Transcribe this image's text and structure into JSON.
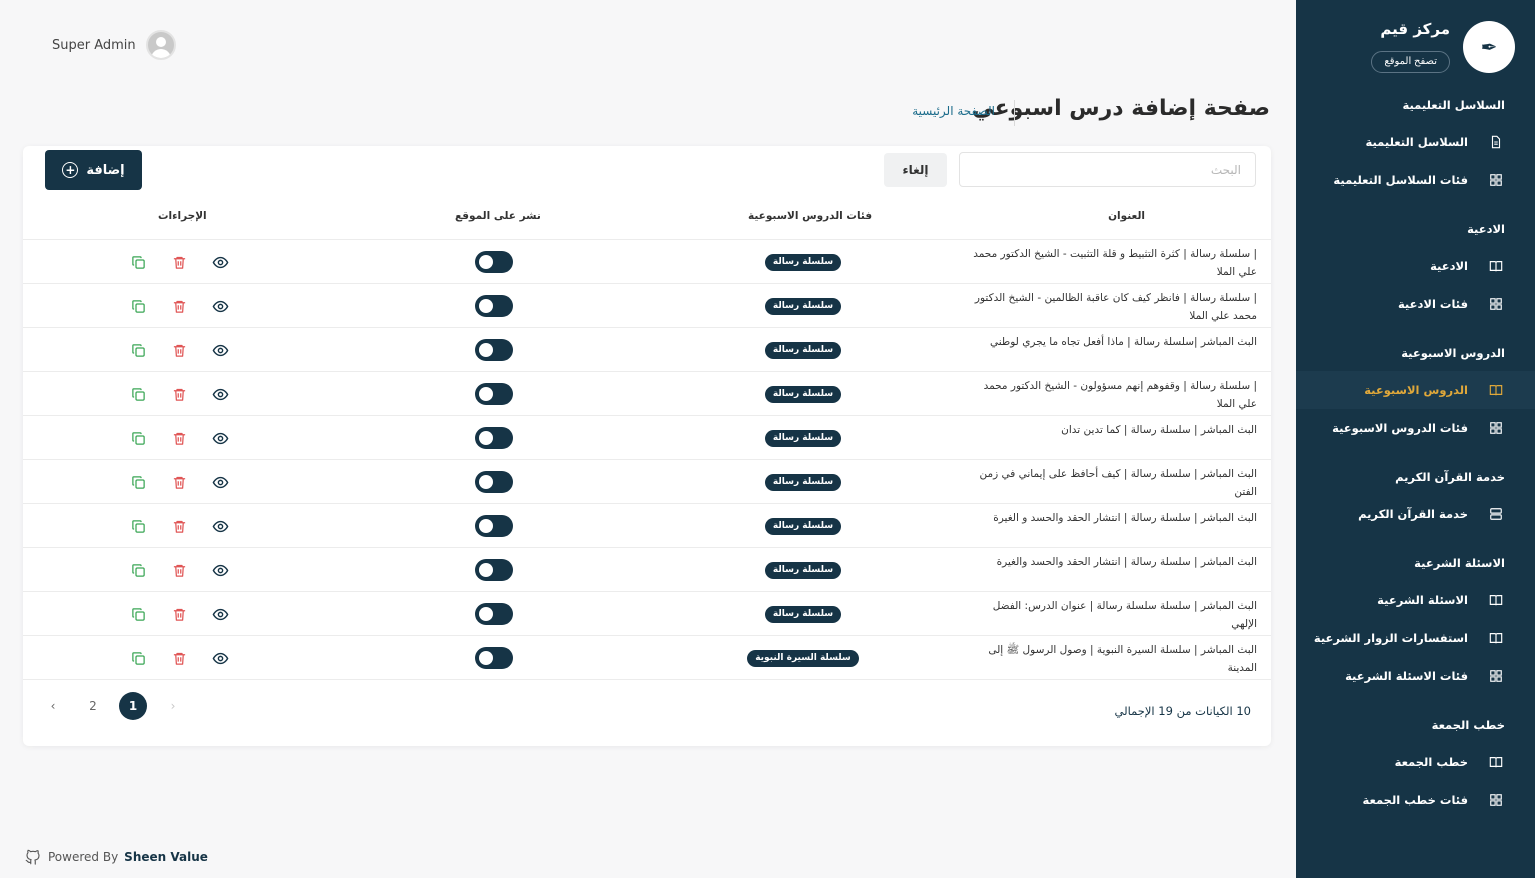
{
  "header": {
    "user_name": "Super Admin",
    "page_title": "صفحة إضافة درس اسبوعي",
    "breadcrumb_home": "الصفحة الرئيسية"
  },
  "sidebar": {
    "brand_name": "مركز قيم",
    "browse_site": "تصفح الموقع",
    "sections": [
      {
        "title": "السلاسل التعليمية",
        "items": [
          {
            "label": "السلاسل التعليمية",
            "icon": "document-icon",
            "active": false
          },
          {
            "label": "فئات السلاسل التعليمية",
            "icon": "grid-icon",
            "active": false
          }
        ]
      },
      {
        "title": "الادعية",
        "items": [
          {
            "label": "الادعية",
            "icon": "book-icon",
            "active": false
          },
          {
            "label": "فئات الادعية",
            "icon": "grid-icon",
            "active": false
          }
        ]
      },
      {
        "title": "الدروس الاسبوعية",
        "items": [
          {
            "label": "الدروس الاسبوعية",
            "icon": "book-icon",
            "active": true
          },
          {
            "label": "فئات الدروس الاسبوعية",
            "icon": "grid-icon",
            "active": false
          }
        ]
      },
      {
        "title": "خدمة القرآن الكريم",
        "items": [
          {
            "label": "خدمة القرآن الكريم",
            "icon": "server-icon",
            "active": false
          }
        ]
      },
      {
        "title": "الاسئلة الشرعية",
        "items": [
          {
            "label": "الاسئلة الشرعية",
            "icon": "book-icon",
            "active": false
          },
          {
            "label": "استفسارات الزوار الشرعية",
            "icon": "book-icon",
            "active": false
          },
          {
            "label": "فئات الاسئلة الشرعية",
            "icon": "grid-icon",
            "active": false
          }
        ]
      },
      {
        "title": "خطب الجمعة",
        "items": [
          {
            "label": "خطب الجمعة",
            "icon": "book-icon",
            "active": false
          },
          {
            "label": "فئات خطب الجمعة",
            "icon": "grid-icon",
            "active": false
          }
        ]
      }
    ]
  },
  "toolbar": {
    "add_label": "إضافة",
    "cancel_label": "إلغاء",
    "search_placeholder": "البحث"
  },
  "table": {
    "columns": {
      "title": "العنوان",
      "category": "فئات الدروس الاسبوعية",
      "publish": "نشر على الموقع",
      "actions": "الإجراءات"
    },
    "rows": [
      {
        "title": "| سلسلة رسالة | كثرة التثبيط و قلة التثبيت - الشيخ الدكتور محمد علي الملا",
        "category": "سلسلة رسالة",
        "published": false
      },
      {
        "title": "| سلسلة رسالة | فانظر كيف كان عاقبة الظالمين - الشيخ الدكتور محمد علي الملا",
        "category": "سلسلة رسالة",
        "published": false
      },
      {
        "title": "البث المباشر |سلسلة رسالة | ماذا أفعل تجاه ما يجري لوطني",
        "category": "سلسلة رسالة",
        "published": false
      },
      {
        "title": "| سلسلة رسالة | وقفوهم إنهم مسؤولون - الشيخ الدكتور محمد علي الملا",
        "category": "سلسلة رسالة",
        "published": false
      },
      {
        "title": "البث المباشر | سلسلة رسالة | كما تدين تدان",
        "category": "سلسلة رسالة",
        "published": false
      },
      {
        "title": "البث المباشر | سلسلة رسالة | كيف أحافظ على إيماني في زمن الفتن",
        "category": "سلسلة رسالة",
        "published": false
      },
      {
        "title": "البث المباشر | سلسلة رسالة | انتشار الحقد والحسد و الغيرة",
        "category": "سلسلة رسالة",
        "published": false
      },
      {
        "title": "البث المباشر | سلسلة رسالة | انتشار الحقد والحسد والغيرة",
        "category": "سلسلة رسالة",
        "published": false
      },
      {
        "title": "البث المباشر | سلسلة سلسلة رسالة | عنوان الدرس: الفضل الإلهي",
        "category": "سلسلة رسالة",
        "published": false
      },
      {
        "title": "البث المباشر | سلسلة السيرة النبوية | وصول الرسول ﷺ إلى المدينة",
        "category": "سلسلة السيرة النبوية",
        "published": false
      }
    ]
  },
  "pagination": {
    "pages": [
      "1",
      "2"
    ],
    "current": "1",
    "prev": "‹",
    "next": "›",
    "summary": "10 الكيانات من 19 الإجمالي"
  },
  "footer": {
    "powered_by": "Powered By",
    "brand": "Sheen Value"
  },
  "colors": {
    "primary": "#163446",
    "active_nav": "#e0a83a",
    "delete": "#e05555",
    "copy": "#3aa655"
  }
}
